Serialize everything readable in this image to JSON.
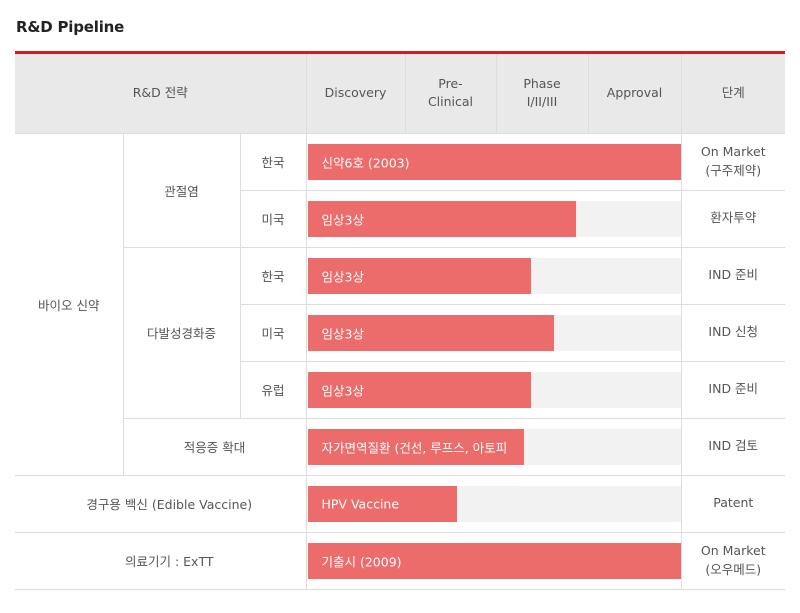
{
  "page_title": "R&D Pipeline",
  "header": {
    "strategy": "R&D 전략",
    "discovery": "Discovery",
    "preclinical_line1": "Pre-",
    "preclinical_line2": "Clinical",
    "phase_line1": "Phase",
    "phase_line2": "I/II/III",
    "approval": "Approval",
    "stage": "단계"
  },
  "categories": {
    "bio": "바이오 신약",
    "arthritis": "관절염",
    "ms": "다발성경화증",
    "expansion": "적응증 확대",
    "vaccine": "경구용 백신 (Edible Vaccine)",
    "device": "의료기기 : ExTT"
  },
  "rows": [
    {
      "region": "한국",
      "bar_label": "신약6호 (2003)",
      "progress": 1.0,
      "stage_line1": "On Market",
      "stage_line2": "(구주제약)"
    },
    {
      "region": "미국",
      "bar_label": "임상3상",
      "progress": 0.72,
      "stage_line1": "환자투약",
      "stage_line2": ""
    },
    {
      "region": "한국",
      "bar_label": "임상3상",
      "progress": 0.6,
      "stage_line1": "IND 준비",
      "stage_line2": ""
    },
    {
      "region": "미국",
      "bar_label": "임상3상",
      "progress": 0.66,
      "stage_line1": "IND 신청",
      "stage_line2": ""
    },
    {
      "region": "유럽",
      "bar_label": "임상3상",
      "progress": 0.6,
      "stage_line1": "IND 준비",
      "stage_line2": ""
    },
    {
      "region": "",
      "bar_label": "자가면역질환 (건선, 루프스, 아토피",
      "progress": 0.58,
      "stage_line1": "IND 검토",
      "stage_line2": ""
    },
    {
      "region": "",
      "bar_label": "HPV Vaccine",
      "progress": 0.4,
      "stage_line1": "Patent",
      "stage_line2": ""
    },
    {
      "region": "",
      "bar_label": "기출시 (2009)",
      "progress": 1.0,
      "stage_line1": "On Market",
      "stage_line2": "(오우메드)"
    }
  ],
  "colors": {
    "accent_rule": "#d71920",
    "bar_fill": "#ec6b6b",
    "bar_track": "#f2f2f2",
    "header_bg": "#e9e9e9"
  }
}
